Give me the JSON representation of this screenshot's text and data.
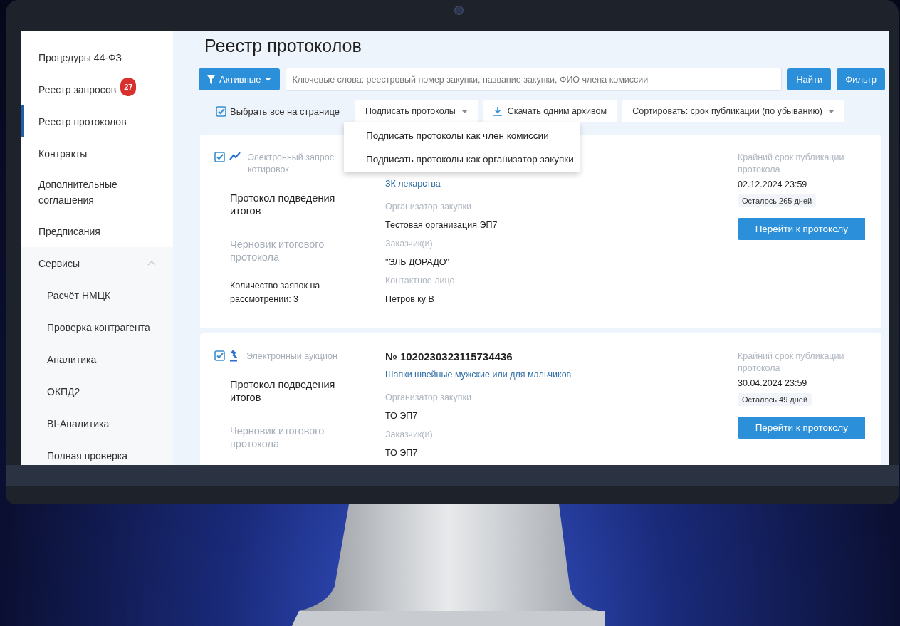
{
  "sidebar": {
    "items": [
      {
        "label": "Процедуры 44-ФЗ",
        "selected": false
      },
      {
        "label": "Реестр запросов",
        "badge": "27",
        "selected": false
      },
      {
        "label": "Реестр протоколов",
        "selected": true
      },
      {
        "label": "Контракты",
        "selected": false
      },
      {
        "label": "Дополнительные соглашения",
        "selected": false
      },
      {
        "label": "Предписания",
        "selected": false
      },
      {
        "label": "Сервисы",
        "selected": false,
        "expanded": true,
        "children": [
          {
            "label": "Расчёт НМЦК",
            "selected": false
          },
          {
            "label": "Проверка контрагента",
            "selected": false
          },
          {
            "label": "Аналитика",
            "selected": false
          },
          {
            "label": "ОКПД2",
            "selected": false
          },
          {
            "label": "BI-Аналитика",
            "selected": false
          },
          {
            "label": "Полная проверка",
            "selected": false
          }
        ]
      }
    ]
  },
  "page_title": "Реестр протоколов",
  "toolbar": {
    "status_filter": "Активные",
    "search": {
      "placeholder": "Ключевые слова: реестровый номер закупки, название закупки, ФИО члена комиссии"
    },
    "find_button": "Найти",
    "filter_button": "Фильтр"
  },
  "actions": {
    "select_all": {
      "label": "Выбрать все на странице",
      "checked": true
    },
    "sign": {
      "label": "Подписать протоколы",
      "expanded": true,
      "menu": [
        "Подписать протоколы как член комиссии",
        "Подписать протоколы как организатор закупки"
      ]
    },
    "download": "Скачать одним архивом",
    "sort": "Сортировать: срок публикации (по убыванию)"
  },
  "cards": [
    {
      "kind": "quotation",
      "checked": true,
      "procedure_type": "Электронный запрос котировок",
      "protocol": "Протокол подведения итогов",
      "draft": "Черновик итогового протокола",
      "applications": "Количество заявок на рассмотрении: 3",
      "title": "ЗК лекарства",
      "details": [
        {
          "label": "Организатор закупки",
          "value": "Тестовая организация ЭП7"
        },
        {
          "label": "Заказчик(и)",
          "value": "\"ЭЛЬ ДОРАДО\""
        },
        {
          "label": "Контактное лицо",
          "value": "Петров ку В"
        }
      ],
      "deadline_label": "Крайний срок публикации протокола",
      "deadline": "02.12.2024 23:59",
      "remaining": "Осталось 265 дней",
      "button": "Перейти к протоколу"
    },
    {
      "kind": "auction",
      "checked": true,
      "procedure_type": "Электронный аукцион",
      "protocol": "Протокол подведения итогов",
      "draft": "Черновик итогового протокола",
      "number": "№ 1020230323115734436",
      "title": "Шапки швейные мужские или для мальчиков",
      "details": [
        {
          "label": "Организатор закупки",
          "value": "ТО ЭП7"
        },
        {
          "label": "Заказчик(и)",
          "value": "ТО ЭП7"
        }
      ],
      "deadline_label": "Крайний срок публикации протокола",
      "deadline": "30.04.2024 23:59",
      "remaining": "Осталось 49 дней",
      "button": "Перейти к протоколу"
    }
  ]
}
